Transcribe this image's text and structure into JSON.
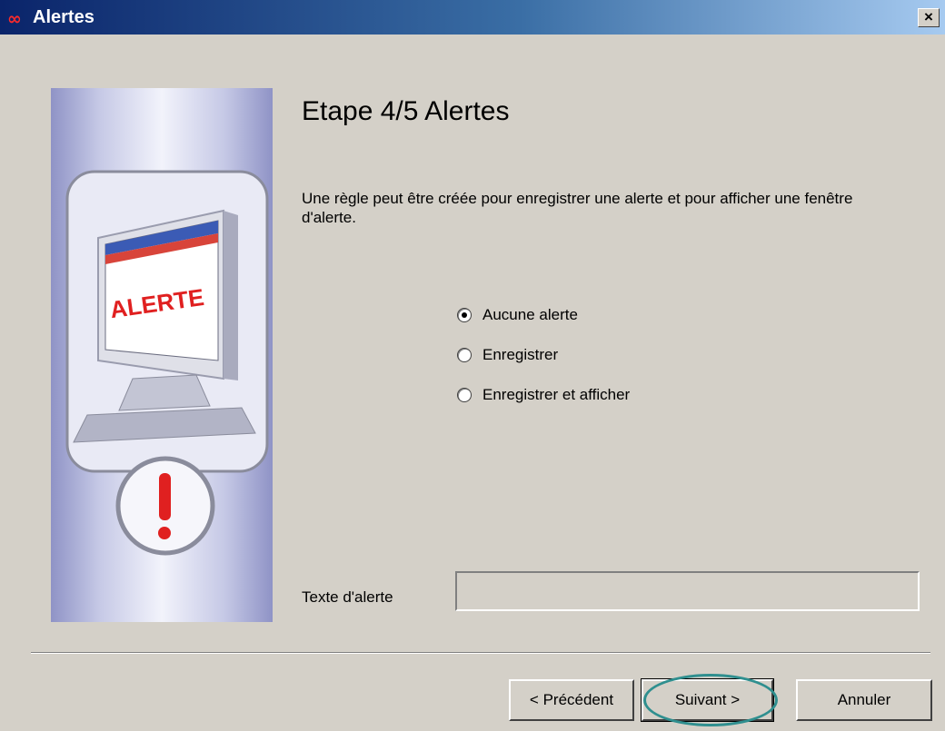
{
  "window": {
    "logo": "∞",
    "title": "Alertes",
    "close_label": "×"
  },
  "illustration": {
    "screen_text": "ALERTE",
    "icon_semantic": "alert-exclamation-icon"
  },
  "step": {
    "title": "Etape 4/5 Alertes",
    "description": "Une règle peut être créée pour enregistrer une alerte et pour afficher une fenêtre d'alerte."
  },
  "options": [
    {
      "label": "Aucune alerte",
      "checked": true
    },
    {
      "label": "Enregistrer",
      "checked": false
    },
    {
      "label": "Enregistrer et afficher",
      "checked": false
    }
  ],
  "alert_text": {
    "label": "Texte d'alerte",
    "value": ""
  },
  "buttons": {
    "previous": "< Précédent",
    "next": "Suivant >",
    "cancel": "Annuler"
  },
  "colors": {
    "accent_highlight": "#2f8f8f",
    "alert_red": "#e02020"
  }
}
